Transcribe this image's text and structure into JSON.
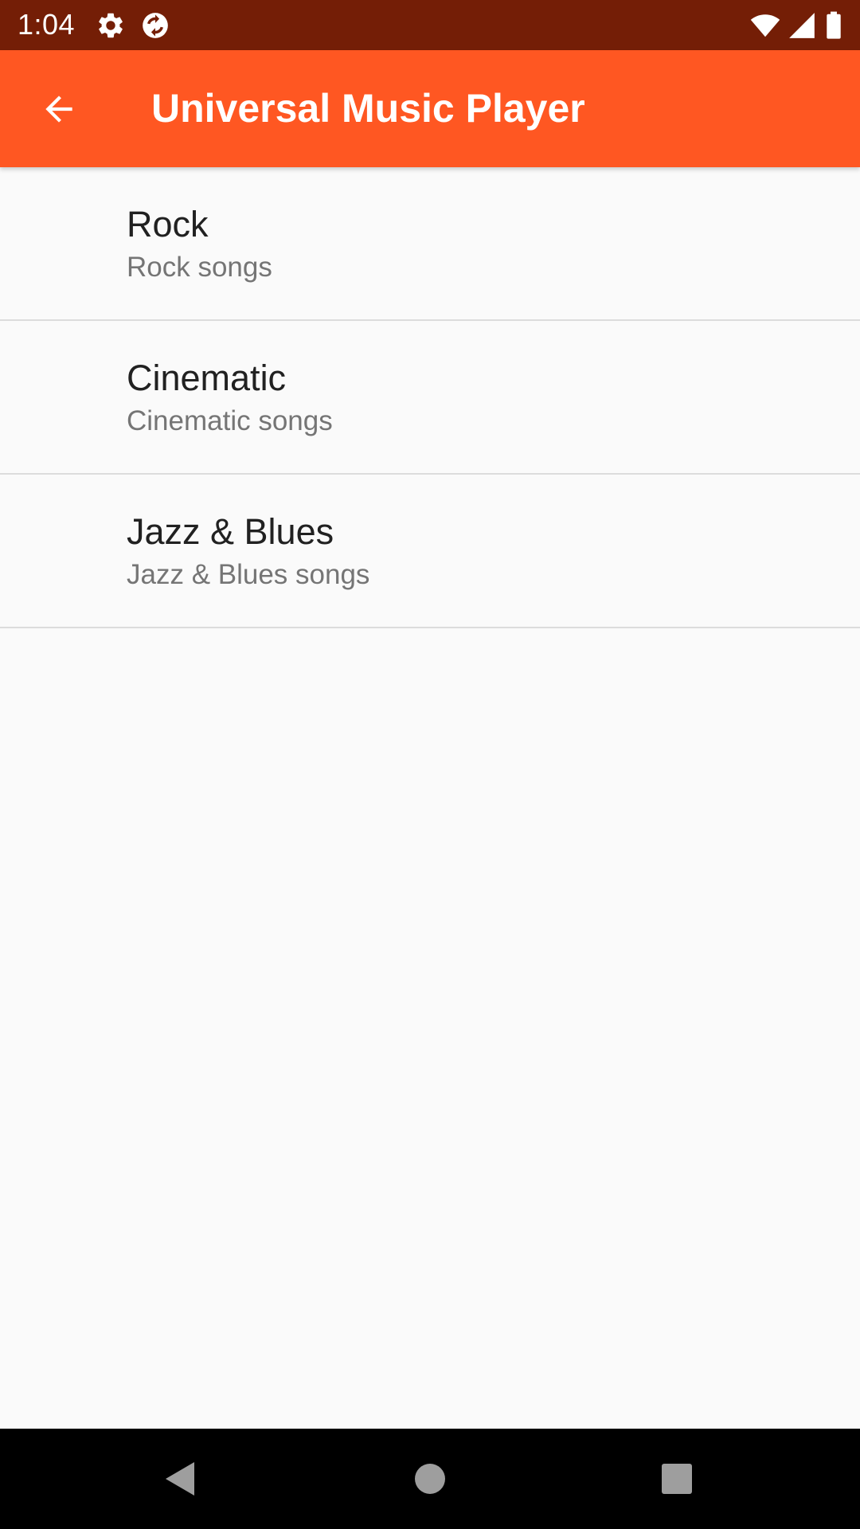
{
  "status_bar": {
    "time": "1:04",
    "icons": [
      "gear-icon",
      "sync-icon",
      "wifi-icon",
      "signal-icon",
      "battery-icon"
    ],
    "background": "#741E06"
  },
  "app_bar": {
    "title": "Universal Music Player",
    "back_icon": "arrow-back-icon",
    "background": "#FF5722"
  },
  "list": {
    "items": [
      {
        "title": "Rock",
        "subtitle": "Rock songs"
      },
      {
        "title": "Cinematic",
        "subtitle": "Cinematic songs"
      },
      {
        "title": "Jazz & Blues",
        "subtitle": "Jazz & Blues songs"
      }
    ]
  },
  "nav_bar": {
    "buttons": [
      "back-triangle-icon",
      "home-circle-icon",
      "recents-square-icon"
    ]
  }
}
